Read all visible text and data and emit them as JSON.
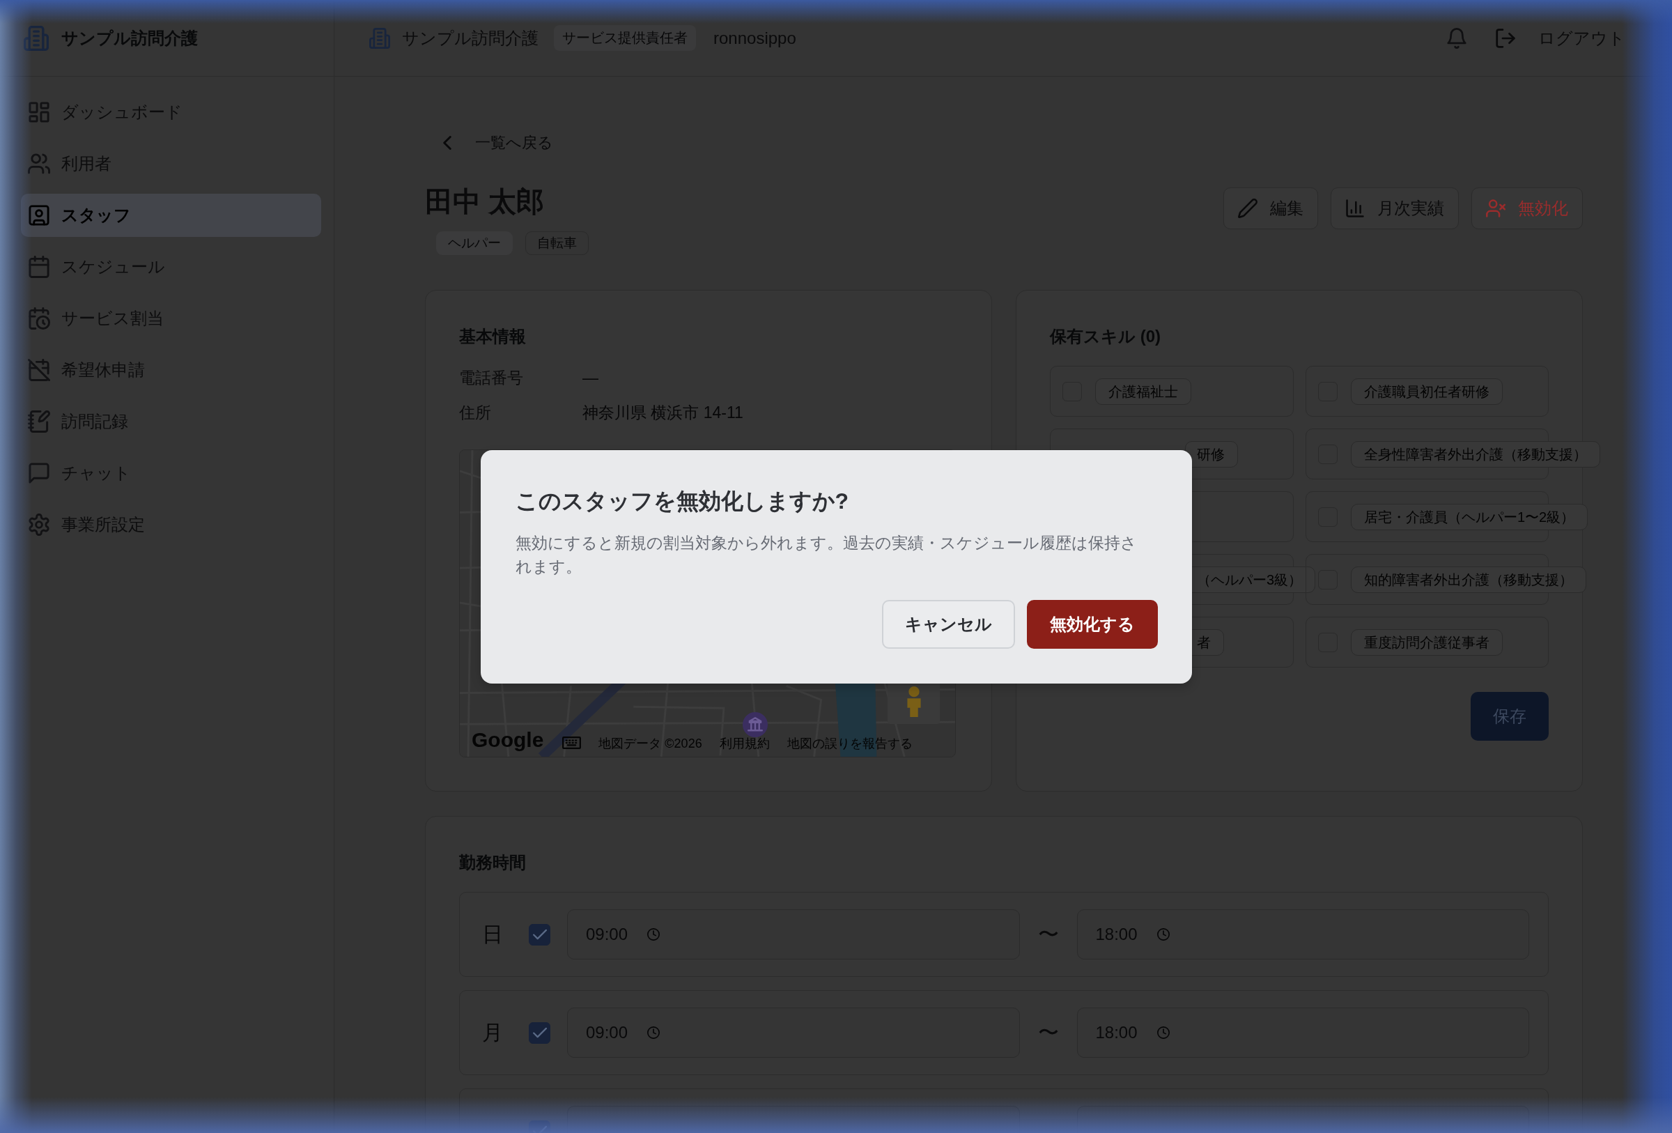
{
  "sidebar": {
    "brand": "サンプル訪問介護",
    "items": [
      {
        "label": "ダッシュボード",
        "selected": false
      },
      {
        "label": "利用者",
        "selected": false
      },
      {
        "label": "スタッフ",
        "selected": true
      },
      {
        "label": "スケジュール",
        "selected": false
      },
      {
        "label": "サービス割当",
        "selected": false
      },
      {
        "label": "希望休申請",
        "selected": false
      },
      {
        "label": "訪問記録",
        "selected": false
      },
      {
        "label": "チャット",
        "selected": false
      },
      {
        "label": "事業所設定",
        "selected": false
      }
    ]
  },
  "header": {
    "office": "サンプル訪問介護",
    "role": "サービス提供責任者",
    "user": "ronnosippo",
    "logout": "ログアウト"
  },
  "back_link": "一覧へ戻る",
  "staff": {
    "name": "田中 太郎",
    "tags": [
      {
        "label": "ヘルパー",
        "kind": "filled"
      },
      {
        "label": "自転車",
        "kind": "outline"
      }
    ],
    "actions": [
      {
        "label": "編集",
        "kind": "edit"
      },
      {
        "label": "月次実績",
        "kind": "report"
      },
      {
        "label": "無効化",
        "kind": "deactivate"
      }
    ]
  },
  "basic_info": {
    "title": "基本情報",
    "fields": [
      {
        "label": "電話番号",
        "value": "—"
      },
      {
        "label": "住所",
        "value": "神奈川県 横浜市 14-11"
      }
    ],
    "map": {
      "logo": "Google",
      "links": [
        "地図データ ©2026",
        "利用規約",
        "地図の誤りを報告する"
      ]
    }
  },
  "skills": {
    "title": "保有スキル (0)",
    "items": [
      {
        "kind": "full",
        "label": "介護福祉士",
        "checked": false
      },
      {
        "kind": "full",
        "label": "介護職員初任者研修",
        "checked": false
      },
      {
        "kind": "tail",
        "label": "研修"
      },
      {
        "kind": "full",
        "label": "全身性障害者外出介護（移動支援）",
        "checked": false
      },
      {
        "kind": "blank"
      },
      {
        "kind": "full",
        "label": "居宅・介護員（ヘルパー1〜2級）",
        "checked": false
      },
      {
        "kind": "tail",
        "label": "（ヘルパー3級）"
      },
      {
        "kind": "full",
        "label": "知的障害者外出介護（移動支援）",
        "checked": false
      },
      {
        "kind": "tail",
        "label": "者"
      },
      {
        "kind": "full",
        "label": "重度訪問介護従事者",
        "checked": false
      }
    ],
    "save": "保存"
  },
  "work_hours": {
    "title": "勤務時間",
    "rows": [
      {
        "day": "日",
        "enabled": true,
        "start": "09:00",
        "separator": "〜",
        "end": "18:00"
      },
      {
        "day": "月",
        "enabled": true,
        "start": "09:00",
        "separator": "〜",
        "end": "18:00"
      },
      {
        "enabled": true
      }
    ]
  },
  "dialog": {
    "title": "このスタッフを無効化しますか?",
    "message": "無効にすると新規の割当対象から外れます。過去の実績・スケジュール履歴は保持されます。",
    "buttons": [
      {
        "label": "キャンセル",
        "kind": "secondary"
      },
      {
        "label": "無効化する",
        "kind": "danger"
      }
    ]
  }
}
